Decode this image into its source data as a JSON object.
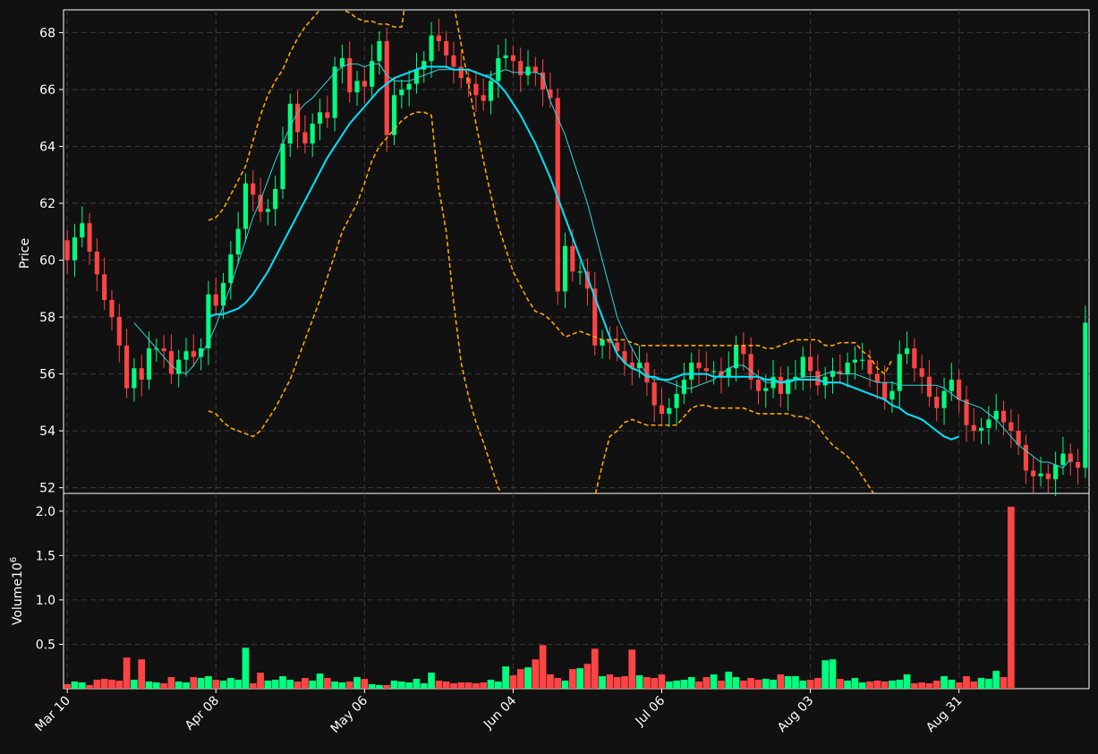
{
  "chart_data": [
    {
      "type": "candlestick",
      "ylabel": "Price",
      "ylim": [
        51.8,
        68.8
      ],
      "yticks": [
        52,
        54,
        56,
        58,
        60,
        62,
        64,
        66,
        68
      ],
      "grid": true,
      "up_color": "#00ff7f",
      "down_color": "#ff4444",
      "ma_fast_color": "#2ed8d8",
      "ma_slow_color": "#00e5ff",
      "band_color": "#ffa500",
      "x_range": [
        0,
        130
      ],
      "closes": [
        60.0,
        60.8,
        61.3,
        60.3,
        59.5,
        58.6,
        58.0,
        57.0,
        55.5,
        56.2,
        55.8,
        56.9,
        56.9,
        56.8,
        56.0,
        56.5,
        56.8,
        56.6,
        56.9,
        58.8,
        58.4,
        59.2,
        60.2,
        61.1,
        62.7,
        62.3,
        61.7,
        61.8,
        62.5,
        64.1,
        65.5,
        64.5,
        64.1,
        64.8,
        65.2,
        65.0,
        66.8,
        67.1,
        65.9,
        66.3,
        66.1,
        67.0,
        67.7,
        64.4,
        65.8,
        66.0,
        66.2,
        66.7,
        67.0,
        67.9,
        67.7,
        67.2,
        66.8,
        66.4,
        66.2,
        65.8,
        65.6,
        66.3,
        67.1,
        67.2,
        67.0,
        66.5,
        66.8,
        66.6,
        66.0,
        65.7,
        58.9,
        60.5,
        59.6,
        59.6,
        59.0,
        57.0,
        57.2,
        57.1,
        56.8,
        56.4,
        56.2,
        56.4,
        55.7,
        54.9,
        54.6,
        54.8,
        55.3,
        55.8,
        56.4,
        56.2,
        56.1,
        56.1,
        55.9,
        56.2,
        57.0,
        56.7,
        55.8,
        55.4,
        55.5,
        55.9,
        55.3,
        55.8,
        55.9,
        56.6,
        56.1,
        55.6,
        55.9,
        56.1,
        56.0,
        56.4,
        56.5,
        56.5,
        56.0,
        55.7,
        55.1,
        55.4,
        56.7,
        56.9,
        56.2,
        55.9,
        55.2,
        54.8,
        55.4,
        55.8,
        55.1,
        54.2,
        54.0,
        54.1,
        54.4,
        54.7,
        54.3,
        54.0,
        53.5,
        52.6,
        52.4,
        52.5,
        52.3,
        52.8,
        53.2,
        52.9,
        52.7,
        57.8
      ],
      "fast_ma": [
        null,
        null,
        null,
        null,
        null,
        null,
        null,
        null,
        null,
        57.8,
        57.5,
        57.2,
        56.9,
        56.6,
        56.3,
        56.1,
        56.0,
        56.3,
        56.7,
        57.1,
        57.7,
        58.4,
        59.1,
        59.9,
        60.7,
        61.5,
        62.1,
        62.8,
        63.5,
        64.1,
        64.7,
        65.2,
        65.5,
        65.7,
        66.0,
        66.3,
        66.6,
        66.8,
        66.9,
        66.9,
        66.8,
        66.9,
        66.9,
        66.5,
        66.3,
        66.3,
        66.3,
        66.4,
        66.5,
        66.6,
        66.7,
        66.7,
        66.7,
        66.7,
        66.7,
        66.6,
        66.5,
        66.5,
        66.6,
        66.7,
        66.6,
        66.6,
        66.6,
        66.6,
        66.5,
        65.6,
        65.0,
        64.4,
        63.6,
        62.8,
        62.0,
        61.0,
        60.0,
        59.0,
        58.0,
        57.4,
        56.9,
        56.4,
        56.0,
        55.8,
        55.8,
        55.7,
        55.6,
        55.5,
        55.5,
        55.6,
        55.7,
        55.8,
        56.0,
        56.2,
        56.3,
        56.3,
        56.1,
        55.9,
        55.7,
        55.7,
        55.7,
        55.8,
        55.8,
        55.9,
        55.9,
        55.9,
        56.0,
        56.1,
        56.0,
        56.0,
        56.0,
        55.9,
        55.8,
        55.7,
        55.7,
        55.7,
        55.6,
        55.6,
        55.6,
        55.6,
        55.6,
        55.6,
        55.5,
        55.3,
        55.1,
        55.0,
        54.9,
        54.8,
        54.6,
        54.4,
        54.1,
        53.8,
        53.5,
        53.3,
        53.1,
        52.9,
        52.9,
        52.8,
        52.7,
        53.0
      ],
      "slow_ma": [
        null,
        null,
        null,
        null,
        null,
        null,
        null,
        null,
        null,
        null,
        null,
        null,
        null,
        null,
        null,
        null,
        null,
        null,
        null,
        58.0,
        58.1,
        58.1,
        58.2,
        58.3,
        58.5,
        58.8,
        59.2,
        59.6,
        60.1,
        60.6,
        61.1,
        61.6,
        62.1,
        62.6,
        63.1,
        63.6,
        64.0,
        64.4,
        64.8,
        65.1,
        65.4,
        65.7,
        66.0,
        66.2,
        66.4,
        66.5,
        66.6,
        66.7,
        66.8,
        66.8,
        66.8,
        66.8,
        66.7,
        66.7,
        66.7,
        66.6,
        66.5,
        66.4,
        66.2,
        65.9,
        65.5,
        65.1,
        64.6,
        64.1,
        63.5,
        62.9,
        62.2,
        61.5,
        60.8,
        60.1,
        59.4,
        58.7,
        58.0,
        57.3,
        56.7,
        56.4,
        56.2,
        56.1,
        55.9,
        55.9,
        55.8,
        55.8,
        55.9,
        56.0,
        56.0,
        56.0,
        56.0,
        55.9,
        55.9,
        55.9,
        55.9,
        55.9,
        55.9,
        55.9,
        55.8,
        55.8,
        55.7,
        55.7,
        55.8,
        55.8,
        55.8,
        55.8,
        55.7,
        55.7,
        55.7,
        55.6,
        55.5,
        55.4,
        55.3,
        55.2,
        55.1,
        54.9,
        54.8,
        54.6,
        54.5,
        54.4,
        54.2,
        54.0,
        53.8,
        53.7,
        53.8
      ],
      "upper_band": [
        null,
        null,
        null,
        null,
        null,
        null,
        null,
        null,
        null,
        null,
        null,
        null,
        null,
        null,
        null,
        null,
        null,
        null,
        null,
        61.4,
        61.5,
        61.8,
        62.3,
        62.8,
        63.3,
        64.2,
        65.1,
        65.8,
        66.3,
        66.7,
        67.3,
        67.8,
        68.2,
        68.5,
        68.8,
        69.0,
        69.0,
        68.8,
        68.7,
        68.5,
        68.4,
        68.4,
        68.3,
        68.3,
        68.2,
        68.2,
        70.0,
        72.0,
        75.0,
        76.0,
        74.0,
        72.0,
        69.0,
        67.6,
        66.2,
        64.8,
        63.5,
        62.3,
        61.2,
        60.4,
        59.6,
        59.1,
        58.6,
        58.2,
        58.1,
        57.9,
        57.6,
        57.3,
        57.4,
        57.5,
        57.4,
        57.3,
        57.2,
        57.2,
        57.2,
        57.2,
        57.1,
        57.0,
        57.0,
        57.0,
        57.0,
        57.0,
        57.0,
        57.0,
        57.0,
        57.0,
        57.0,
        57.0,
        57.0,
        57.0,
        57.0,
        57.0,
        57.0,
        57.0,
        56.9,
        56.9,
        57.0,
        57.1,
        57.2,
        57.2,
        57.2,
        57.2,
        57.0,
        57.0,
        57.1,
        57.1,
        57.1,
        56.8,
        56.6,
        56.2,
        56.0,
        56.5
      ],
      "lower_band": [
        null,
        null,
        null,
        null,
        null,
        null,
        null,
        null,
        null,
        null,
        null,
        null,
        null,
        null,
        null,
        null,
        null,
        null,
        null,
        54.7,
        54.6,
        54.3,
        54.1,
        54.0,
        53.9,
        53.8,
        54.0,
        54.4,
        54.8,
        55.3,
        55.8,
        56.5,
        57.2,
        57.9,
        58.6,
        59.4,
        60.2,
        61.0,
        61.5,
        62.0,
        62.7,
        63.5,
        64.0,
        64.3,
        64.6,
        64.9,
        65.1,
        65.2,
        65.2,
        65.1,
        62.5,
        61.0,
        58.5,
        56.4,
        55.2,
        54.3,
        53.6,
        52.8,
        52.0,
        51.5,
        51.0,
        50.3,
        49.2,
        48.4,
        47.7,
        46.8,
        45.9,
        46.5,
        48.6,
        50.0,
        51.0,
        51.7,
        52.8,
        53.8,
        54.0,
        54.3,
        54.4,
        54.3,
        54.2,
        54.2,
        54.2,
        54.2,
        54.2,
        54.5,
        54.8,
        54.9,
        54.9,
        54.8,
        54.8,
        54.8,
        54.8,
        54.8,
        54.7,
        54.6,
        54.6,
        54.6,
        54.6,
        54.6,
        54.5,
        54.5,
        54.4,
        54.2,
        53.8,
        53.5,
        53.3,
        53.1,
        52.8,
        52.4,
        52.0,
        51.6
      ],
      "opens": null
    },
    {
      "type": "bar",
      "ylabel": "Volume",
      "yunit": "10",
      "yunit_exp": "6",
      "ylim": [
        0,
        2.2
      ],
      "yticks": [
        0.5,
        1.0,
        1.5,
        2.0
      ],
      "ytick_labels": [
        "0.5",
        "1.0",
        "1.5",
        "2.0"
      ],
      "grid": true,
      "values": [
        0.05,
        0.08,
        0.07,
        0.04,
        0.1,
        0.11,
        0.1,
        0.09,
        0.35,
        0.1,
        0.33,
        0.08,
        0.07,
        0.06,
        0.13,
        0.08,
        0.07,
        0.13,
        0.12,
        0.14,
        0.1,
        0.09,
        0.12,
        0.1,
        0.46,
        0.06,
        0.18,
        0.09,
        0.1,
        0.14,
        0.1,
        0.08,
        0.12,
        0.09,
        0.17,
        0.12,
        0.08,
        0.07,
        0.08,
        0.13,
        0.11,
        0.05,
        0.04,
        0.04,
        0.09,
        0.08,
        0.07,
        0.11,
        0.06,
        0.18,
        0.09,
        0.08,
        0.06,
        0.07,
        0.07,
        0.06,
        0.07,
        0.1,
        0.08,
        0.25,
        0.15,
        0.22,
        0.24,
        0.33,
        0.49,
        0.16,
        0.12,
        0.09,
        0.22,
        0.23,
        0.28,
        0.45,
        0.14,
        0.16,
        0.13,
        0.14,
        0.44,
        0.15,
        0.13,
        0.12,
        0.16,
        0.08,
        0.09,
        0.1,
        0.13,
        0.08,
        0.13,
        0.16,
        0.09,
        0.19,
        0.13,
        0.09,
        0.12,
        0.1,
        0.11,
        0.1,
        0.16,
        0.14,
        0.14,
        0.09,
        0.1,
        0.12,
        0.32,
        0.33,
        0.11,
        0.09,
        0.12,
        0.07,
        0.08,
        0.09,
        0.08,
        0.09,
        0.1,
        0.16,
        0.06,
        0.07,
        0.06,
        0.09,
        0.14,
        0.1,
        0.07,
        0.14,
        0.08,
        0.12,
        0.11,
        0.2,
        0.13,
        2.05
      ]
    }
  ],
  "x_axis": {
    "tick_labels": [
      "Mar 10",
      "Apr 08",
      "May 06",
      "Jun 04",
      "Jul 06",
      "Aug 03",
      "Aug 31"
    ],
    "tick_index": [
      0,
      20,
      40,
      60,
      80,
      100,
      120
    ]
  }
}
